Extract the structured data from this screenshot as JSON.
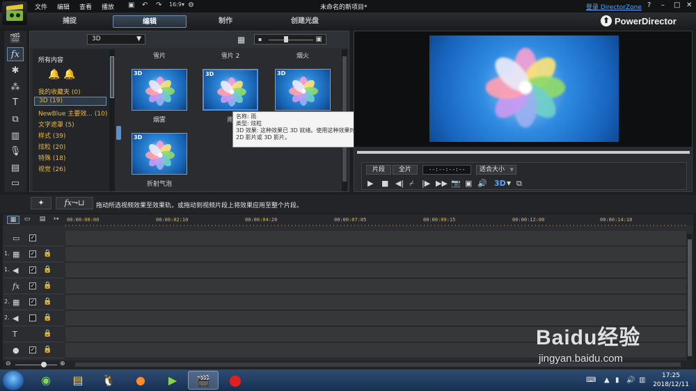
{
  "titlebar": {
    "menus": [
      "文件",
      "编辑",
      "查看",
      "播放"
    ],
    "title": "未命名的新项目*",
    "login": "登录 DirectorZone",
    "help": "?",
    "minimize": "–",
    "maximize": "□",
    "close": "✕"
  },
  "modes": {
    "capture": "捕捉",
    "edit": "编辑",
    "produce": "制作",
    "disc": "创建光盘",
    "brand": "PowerDirector"
  },
  "library": {
    "filter": "3D",
    "all_content": "所有内容",
    "categories": [
      {
        "label": "我的收藏夹  (0)"
      },
      {
        "label": "3D  (19)"
      },
      {
        "label": "NewBlue 主要效...  (10)"
      },
      {
        "label": "文字遮罩  (5)"
      },
      {
        "label": "样式  (39)"
      },
      {
        "label": "炫粒  (20)"
      },
      {
        "label": "特殊  (18)"
      },
      {
        "label": "视觉  (26)"
      }
    ],
    "top_labels": [
      "雪片",
      "雪片 2",
      "烟火"
    ],
    "thumbs": [
      {
        "tag": "3D",
        "label": "烟雾"
      },
      {
        "tag": "3D",
        "label": "雨"
      },
      {
        "tag": "3D",
        "label": ""
      },
      {
        "tag": "3D",
        "label": "折射气泡"
      }
    ]
  },
  "tooltip": {
    "line1": "名称: 雨",
    "line2": "类型: 炫粒",
    "line3": "3D 效果: 这种效果已 3D 就绪。使用这种效果时，可以将视频输出为标准",
    "line4": "2D 影片或 3D 影片。"
  },
  "preview": {
    "clip": "片段",
    "full": "全片",
    "timecode": "--:--:--:--",
    "fit": "适合大小",
    "fit_arrow": "▼",
    "threed": "3D"
  },
  "midbar": {
    "hint": "拖动所选视频效果至效果轨，或拖动到视频片段上将效果应用至整个片段。"
  },
  "timeline": {
    "ruler": [
      "00:00:00:00",
      "00:00:02:10",
      "00:00:04:20",
      "00:00:07:05",
      "00:00:09:15",
      "00:00:12:00",
      "00:00:14:10"
    ],
    "tracks": [
      {
        "num": "",
        "icon": "▭",
        "checked": true,
        "lock": ""
      },
      {
        "num": "1.",
        "icon": "▦",
        "checked": true,
        "lock": "🔒"
      },
      {
        "num": "1.",
        "icon": "◀",
        "checked": true,
        "lock": "🔒"
      },
      {
        "num": "",
        "icon": "fx",
        "checked": true,
        "lock": "🔒"
      },
      {
        "num": "2.",
        "icon": "▦",
        "checked": true,
        "lock": "🔒"
      },
      {
        "num": "2.",
        "icon": "◀",
        "checked": false,
        "lock": "🔒"
      },
      {
        "num": "",
        "icon": "T",
        "checked": null,
        "lock": "🔒"
      },
      {
        "num": "",
        "icon": "●",
        "checked": true,
        "lock": "🔒"
      }
    ]
  },
  "taskbar": {
    "time": "17:25",
    "date": "2018/12/11"
  },
  "watermark": {
    "text": "Baidu经验",
    "url": "jingyan.baidu.com"
  }
}
